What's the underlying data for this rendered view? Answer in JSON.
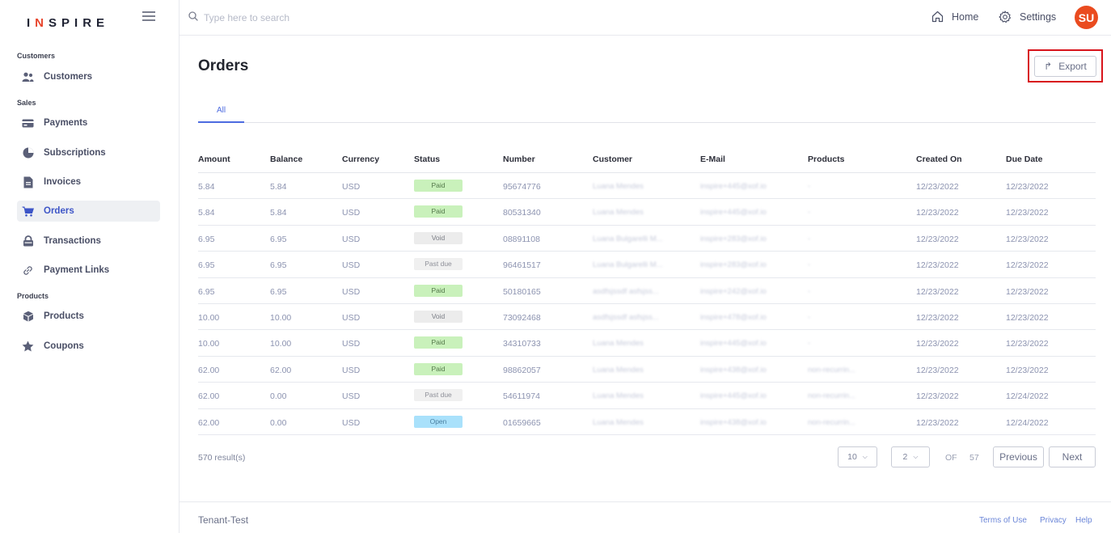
{
  "app": {
    "logo_prefix": "I",
    "logo_accent": "N",
    "logo_suffix": "SPIRE"
  },
  "sidebar": {
    "sections": [
      {
        "label": "Customers"
      },
      {
        "label": "Sales"
      },
      {
        "label": "Products"
      }
    ],
    "items": [
      {
        "label": "Customers",
        "icon": "users-icon"
      },
      {
        "label": "Payments",
        "icon": "card-icon"
      },
      {
        "label": "Subscriptions",
        "icon": "pie-icon"
      },
      {
        "label": "Invoices",
        "icon": "document-icon"
      },
      {
        "label": "Orders",
        "icon": "cart-icon",
        "active": true
      },
      {
        "label": "Transactions",
        "icon": "lock-icon"
      },
      {
        "label": "Payment Links",
        "icon": "link-icon"
      },
      {
        "label": "Products",
        "icon": "box-icon"
      },
      {
        "label": "Coupons",
        "icon": "star-icon"
      }
    ]
  },
  "topbar": {
    "search_placeholder": "Type here to search",
    "home_label": "Home",
    "settings_label": "Settings",
    "avatar_initials": "SU"
  },
  "main": {
    "title": "Orders",
    "export_label": "Export",
    "tabs": [
      {
        "label": "All"
      }
    ]
  },
  "table": {
    "columns": [
      "Amount",
      "Balance",
      "Currency",
      "Status",
      "Number",
      "Customer",
      "E-Mail",
      "Products",
      "Created On",
      "Due Date"
    ],
    "rows": [
      {
        "amount": "5.84",
        "balance": "5.84",
        "currency": "USD",
        "status": "Paid",
        "number": "95674776",
        "customer": "Luana Mendes",
        "email": "inspire+445@xof.io",
        "products": "-",
        "created": "12/23/2022",
        "due": "12/23/2022"
      },
      {
        "amount": "5.84",
        "balance": "5.84",
        "currency": "USD",
        "status": "Paid",
        "number": "80531340",
        "customer": "Luana Mendes",
        "email": "inspire+445@xof.io",
        "products": "-",
        "created": "12/23/2022",
        "due": "12/23/2022"
      },
      {
        "amount": "6.95",
        "balance": "6.95",
        "currency": "USD",
        "status": "Void",
        "number": "08891108",
        "customer": "Luana Bulgarelli M...",
        "email": "inspire+283@xof.io",
        "products": "-",
        "created": "12/23/2022",
        "due": "12/23/2022"
      },
      {
        "amount": "6.95",
        "balance": "6.95",
        "currency": "USD",
        "status": "Past due",
        "number": "96461517",
        "customer": "Luana Bulgarelli M...",
        "email": "inspire+283@xof.io",
        "products": "-",
        "created": "12/23/2022",
        "due": "12/23/2022"
      },
      {
        "amount": "6.95",
        "balance": "6.95",
        "currency": "USD",
        "status": "Paid",
        "number": "50180165",
        "customer": "asdfsjssdf asfsjss...",
        "email": "inspire+242@xof.io",
        "products": "-",
        "created": "12/23/2022",
        "due": "12/23/2022"
      },
      {
        "amount": "10.00",
        "balance": "10.00",
        "currency": "USD",
        "status": "Void",
        "number": "73092468",
        "customer": "asdfsjssdf asfsjss...",
        "email": "inspire+478@xof.io",
        "products": "-",
        "created": "12/23/2022",
        "due": "12/23/2022"
      },
      {
        "amount": "10.00",
        "balance": "10.00",
        "currency": "USD",
        "status": "Paid",
        "number": "34310733",
        "customer": "Luana Mendes",
        "email": "inspire+445@xof.io",
        "products": "-",
        "created": "12/23/2022",
        "due": "12/23/2022"
      },
      {
        "amount": "62.00",
        "balance": "62.00",
        "currency": "USD",
        "status": "Paid",
        "number": "98862057",
        "customer": "Luana Mendes",
        "email": "inspire+438@xof.io",
        "products": "non-recurrin...",
        "created": "12/23/2022",
        "due": "12/23/2022"
      },
      {
        "amount": "62.00",
        "balance": "0.00",
        "currency": "USD",
        "status": "Past due",
        "number": "54611974",
        "customer": "Luana Mendes",
        "email": "inspire+445@xof.io",
        "products": "non-recurrin...",
        "created": "12/23/2022",
        "due": "12/24/2022"
      },
      {
        "amount": "62.00",
        "balance": "0.00",
        "currency": "USD",
        "status": "Open",
        "number": "01659665",
        "customer": "Luana Mendes",
        "email": "inspire+438@xof.io",
        "products": "non-recurrin...",
        "created": "12/23/2022",
        "due": "12/24/2022"
      }
    ]
  },
  "pagination": {
    "results": "570 result(s)",
    "page_size": "10",
    "current_page": "2",
    "of_label": "OF",
    "total_pages": "57",
    "previous_label": "Previous",
    "next_label": "Next"
  },
  "footer": {
    "tenant": "Tenant-Test",
    "terms": "Terms of Use",
    "privacy": "Privacy",
    "help": "Help"
  },
  "colors": {
    "accent": "#4d6be0",
    "avatar": "#ea4b1f",
    "highlight": "#d8141b",
    "paid": "#c9f1bb",
    "open": "#a9e1fb"
  }
}
